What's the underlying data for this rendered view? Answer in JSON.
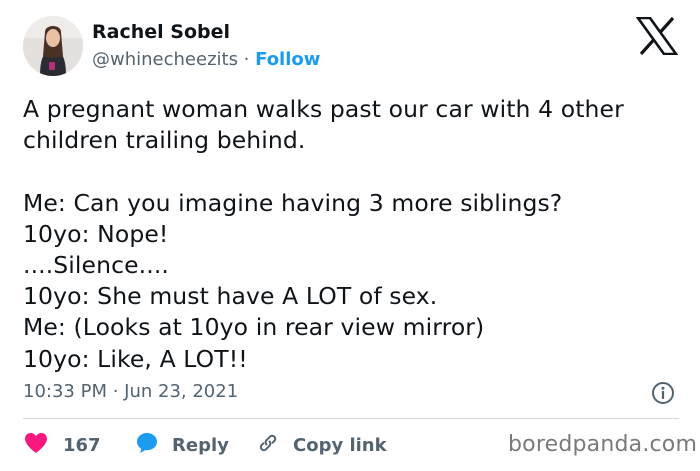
{
  "author": {
    "name": "Rachel Sobel",
    "handle": "@whinecheezits",
    "separator": " · ",
    "follow_label": "Follow"
  },
  "tweet": {
    "text": "A pregnant woman walks past our car with 4 other children trailing behind.\n\nMe: Can you imagine having 3 more siblings?\n10yo: Nope!\n....Silence....\n10yo: She must have A LOT of sex.\nMe: (Looks at 10yo in rear view mirror)\n10yo: Like, A LOT!!",
    "timestamp": "10:33 PM · Jun 23, 2021"
  },
  "actions": {
    "like_count": "167",
    "reply_label": "Reply",
    "copy_link_label": "Copy link"
  },
  "watermark": "boredpanda.com",
  "colors": {
    "text": "#0f1419",
    "secondary": "#536471",
    "accent": "#1d9bf0",
    "like": "#f91880",
    "divider": "#cfd9de"
  },
  "icons": {
    "brand": "x-logo-icon",
    "info": "info-icon",
    "like": "heart-icon",
    "reply": "speech-bubble-icon",
    "copy": "link-icon"
  }
}
